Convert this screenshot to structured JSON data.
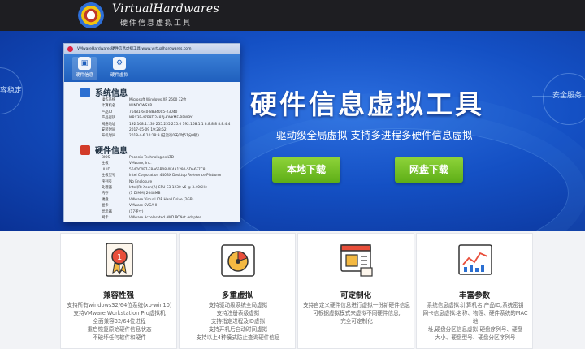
{
  "header": {
    "logo_title": "VirtualHardwares",
    "logo_subtitle": "硬件信息虚拟工具"
  },
  "hero": {
    "headline": "硬件信息虚拟工具",
    "subline": "驱动级全局虚拟 支持多进程多硬件信息虚拟",
    "left_tag": "容稳定",
    "right_tag": "安全服务",
    "buttons": {
      "local": "本地下载",
      "pan": "网盘下载"
    },
    "colors": {
      "button_green": "#6ebf22",
      "hero_blue": "#1450c4"
    }
  },
  "app_window": {
    "title": "VMwareHardwares硬件信息虚拟工具   www.virtualhardwares.com",
    "tabs": [
      {
        "label": "硬件信息",
        "icon": "monitor-icon"
      },
      {
        "label": "硬件虚拟",
        "icon": "gear-icon"
      }
    ],
    "system_section": {
      "title": "系统信息",
      "rows": [
        {
          "k": "操作系统",
          "v": "Microsoft Windows XP 2600 32位"
        },
        {
          "k": "计算机名",
          "v": "WINDOWSXP"
        },
        {
          "k": "产品ID",
          "v": "76481-640-8834005-23040"
        },
        {
          "k": "产品密钥",
          "v": "MRX3F-47B9T-2487J-KWKMF-RPWBY"
        },
        {
          "k": "网络地址",
          "v": "192.168.1.130 255.255.255.0 192.168.1.1 8.8.8.8 8.8.4.4"
        },
        {
          "k": "安装时间",
          "v": "2017-05-09 19:28:52"
        },
        {
          "k": "开机时间",
          "v": "2018-4-6 10:18:9  (已运行0天0时51分0秒)"
        }
      ]
    },
    "hardware_section": {
      "title": "硬件信息",
      "rows": [
        {
          "k": "BIOS",
          "v": "Phoenix Technologies LTD"
        },
        {
          "k": "主板",
          "v": "VMware, Inc."
        },
        {
          "k": "UUID",
          "v": "564DC0F7-F8A65B08-0F4A1290-5DA6F7C8"
        },
        {
          "k": "主板型号",
          "v": "Intel Corporation 440BX Desktop Reference Platform"
        },
        {
          "k": "序列号",
          "v": "No Enclosure"
        },
        {
          "k": "处理器",
          "v": "Intel(R) Xeon(R) CPU E3-1230 v6 @ 3.40GHz"
        },
        {
          "k": "内存",
          "v": "(1 DIMM) 2048MB"
        },
        {
          "k": "硬盘",
          "v": "VMware Virtual IDE Hard Drive (2GB)"
        },
        {
          "k": "显卡",
          "v": "VMware SVGA II"
        },
        {
          "k": "显示器",
          "v": "(17英寸)"
        },
        {
          "k": "网卡",
          "v": "VMware Accelerated AMD PCNet Adapter"
        }
      ]
    }
  },
  "features": [
    {
      "title": "兼容性强",
      "icon": "compat-icon",
      "desc": [
        "支持所有windows32/64位系统(xp-win10)",
        "支持VMware Workstation Pro虚拟机",
        "全面兼容32/64位进程",
        "重启恢复原始硬件信息状态",
        "不破坏任何软件和硬件"
      ]
    },
    {
      "title": "多重虚拟",
      "icon": "multi-virtual-icon",
      "desc": [
        "支持驱动级系统全局虚拟",
        "支持注册表级虚拟",
        "支持指定进程及ID虚拟",
        "支持开机后自动时间虚拟",
        "支持以上4种模式防止查询硬件信息"
      ]
    },
    {
      "title": "可定制化",
      "icon": "customize-icon",
      "desc": [
        "支持自定义硬件信息进行虚拟一份新硬件信息",
        "可根据虚拟模式来虚拟不同硬件信息,",
        "完全可定制化"
      ]
    },
    {
      "title": "丰富参数",
      "icon": "params-icon",
      "desc": [
        "系统信息虚拟:计算机名,产品ID,系统密钥",
        "网卡信息虚拟:名称、物理、硬件系统的MAC地",
        "址,硬盘分区信息虚拟:硬盘序列号、硬盘",
        "大小、硬盘型号、硬盘分区序列号"
      ]
    }
  ]
}
